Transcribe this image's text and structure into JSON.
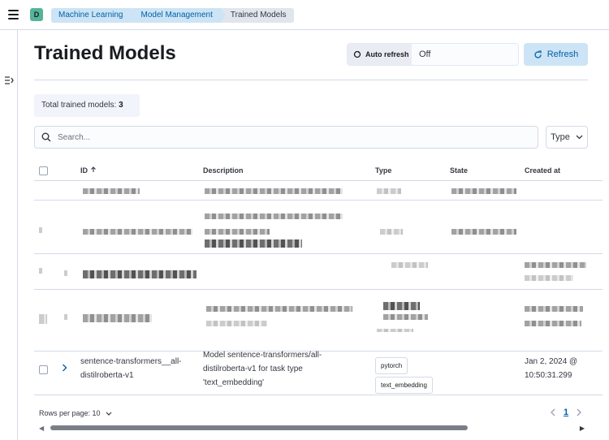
{
  "breadcrumbs": [
    "Machine Learning",
    "Model Management",
    "Trained Models"
  ],
  "avatar_letter": "D",
  "page_title": "Trained Models",
  "auto_refresh": {
    "label": "Auto refresh",
    "value": "Off"
  },
  "refresh_label": "Refresh",
  "total": {
    "label": "Total trained models:",
    "count": "3"
  },
  "search_placeholder": "Search...",
  "type_filter_label": "Type",
  "columns": {
    "id": "ID",
    "description": "Description",
    "type": "Type",
    "state": "State",
    "created": "Created at"
  },
  "visible_row": {
    "id_line1": "sentence-transformers__all-",
    "id_line2": "distilroberta-v1",
    "desc_line1": "Model sentence-transformers/all-",
    "desc_line2": "distilroberta-v1 for task type",
    "desc_line3": "'text_embedding'",
    "types": [
      "pytorch",
      "text_embedding"
    ],
    "created_line1": "Jan 2, 2024 @",
    "created_line2": "10:50:31.299"
  },
  "footer": {
    "rows_per_page": "Rows per page: 10",
    "current_page": "1"
  },
  "icons": [
    "menu-icon",
    "nav-collapse-icon",
    "refresh-cycle-icon",
    "search-icon",
    "chevron-down-icon",
    "sort-up-icon",
    "chevron-right-icon",
    "chevron-left-icon"
  ]
}
